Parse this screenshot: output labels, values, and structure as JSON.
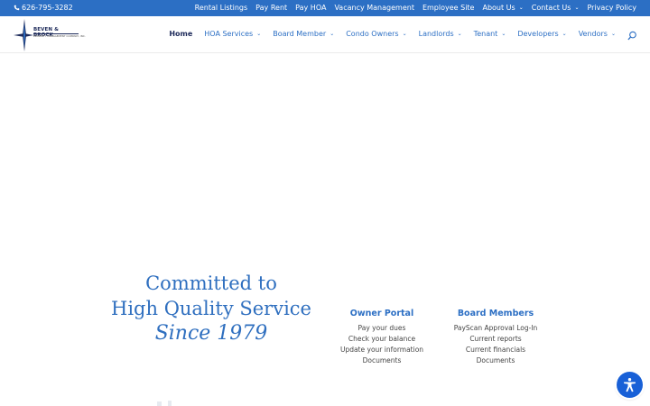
{
  "topbar": {
    "phone": "626-795-3282",
    "links": [
      {
        "label": "Rental Listings",
        "dropdown": false
      },
      {
        "label": "Pay Rent",
        "dropdown": false
      },
      {
        "label": "Pay HOA",
        "dropdown": false
      },
      {
        "label": "Vacancy Management",
        "dropdown": false
      },
      {
        "label": "Employee Site",
        "dropdown": false
      },
      {
        "label": "About Us",
        "dropdown": true
      },
      {
        "label": "Contact Us",
        "dropdown": true
      },
      {
        "label": "Privacy Policy",
        "dropdown": false
      }
    ]
  },
  "logo": {
    "name": "BEVEN & BROCK",
    "subtitle": "PROPERTY MANAGEMENT COMPANY, INC."
  },
  "mainnav": {
    "items": [
      {
        "label": "Home",
        "dropdown": false,
        "active": true
      },
      {
        "label": "HOA Services",
        "dropdown": true
      },
      {
        "label": "Board Member",
        "dropdown": true
      },
      {
        "label": "Condo Owners",
        "dropdown": true
      },
      {
        "label": "Landlords",
        "dropdown": true
      },
      {
        "label": "Tenant",
        "dropdown": true
      },
      {
        "label": "Developers",
        "dropdown": true
      },
      {
        "label": "Vendors",
        "dropdown": true
      }
    ]
  },
  "hero": {
    "line1": "Committed to",
    "line2": "High Quality Service",
    "line3": "Since 1979"
  },
  "owner_portal": {
    "title": "Owner Portal",
    "links": [
      "Pay your dues",
      "Check your balance",
      "Update your information",
      "Documents"
    ]
  },
  "board_members": {
    "title": "Board Members",
    "links": [
      "PayScan Approval Log-In",
      "Current reports",
      "Current financials",
      "Documents"
    ]
  },
  "icons": {
    "phone": "phone-icon",
    "search": "search-icon",
    "accessibility": "accessibility-icon"
  },
  "colors": {
    "topbar": "#2c6fc4",
    "accent": "#2c6fc4",
    "hero_text": "#2f6fbf",
    "nav_active": "#1d2a5a",
    "accessibility_button": "#1860d7"
  }
}
